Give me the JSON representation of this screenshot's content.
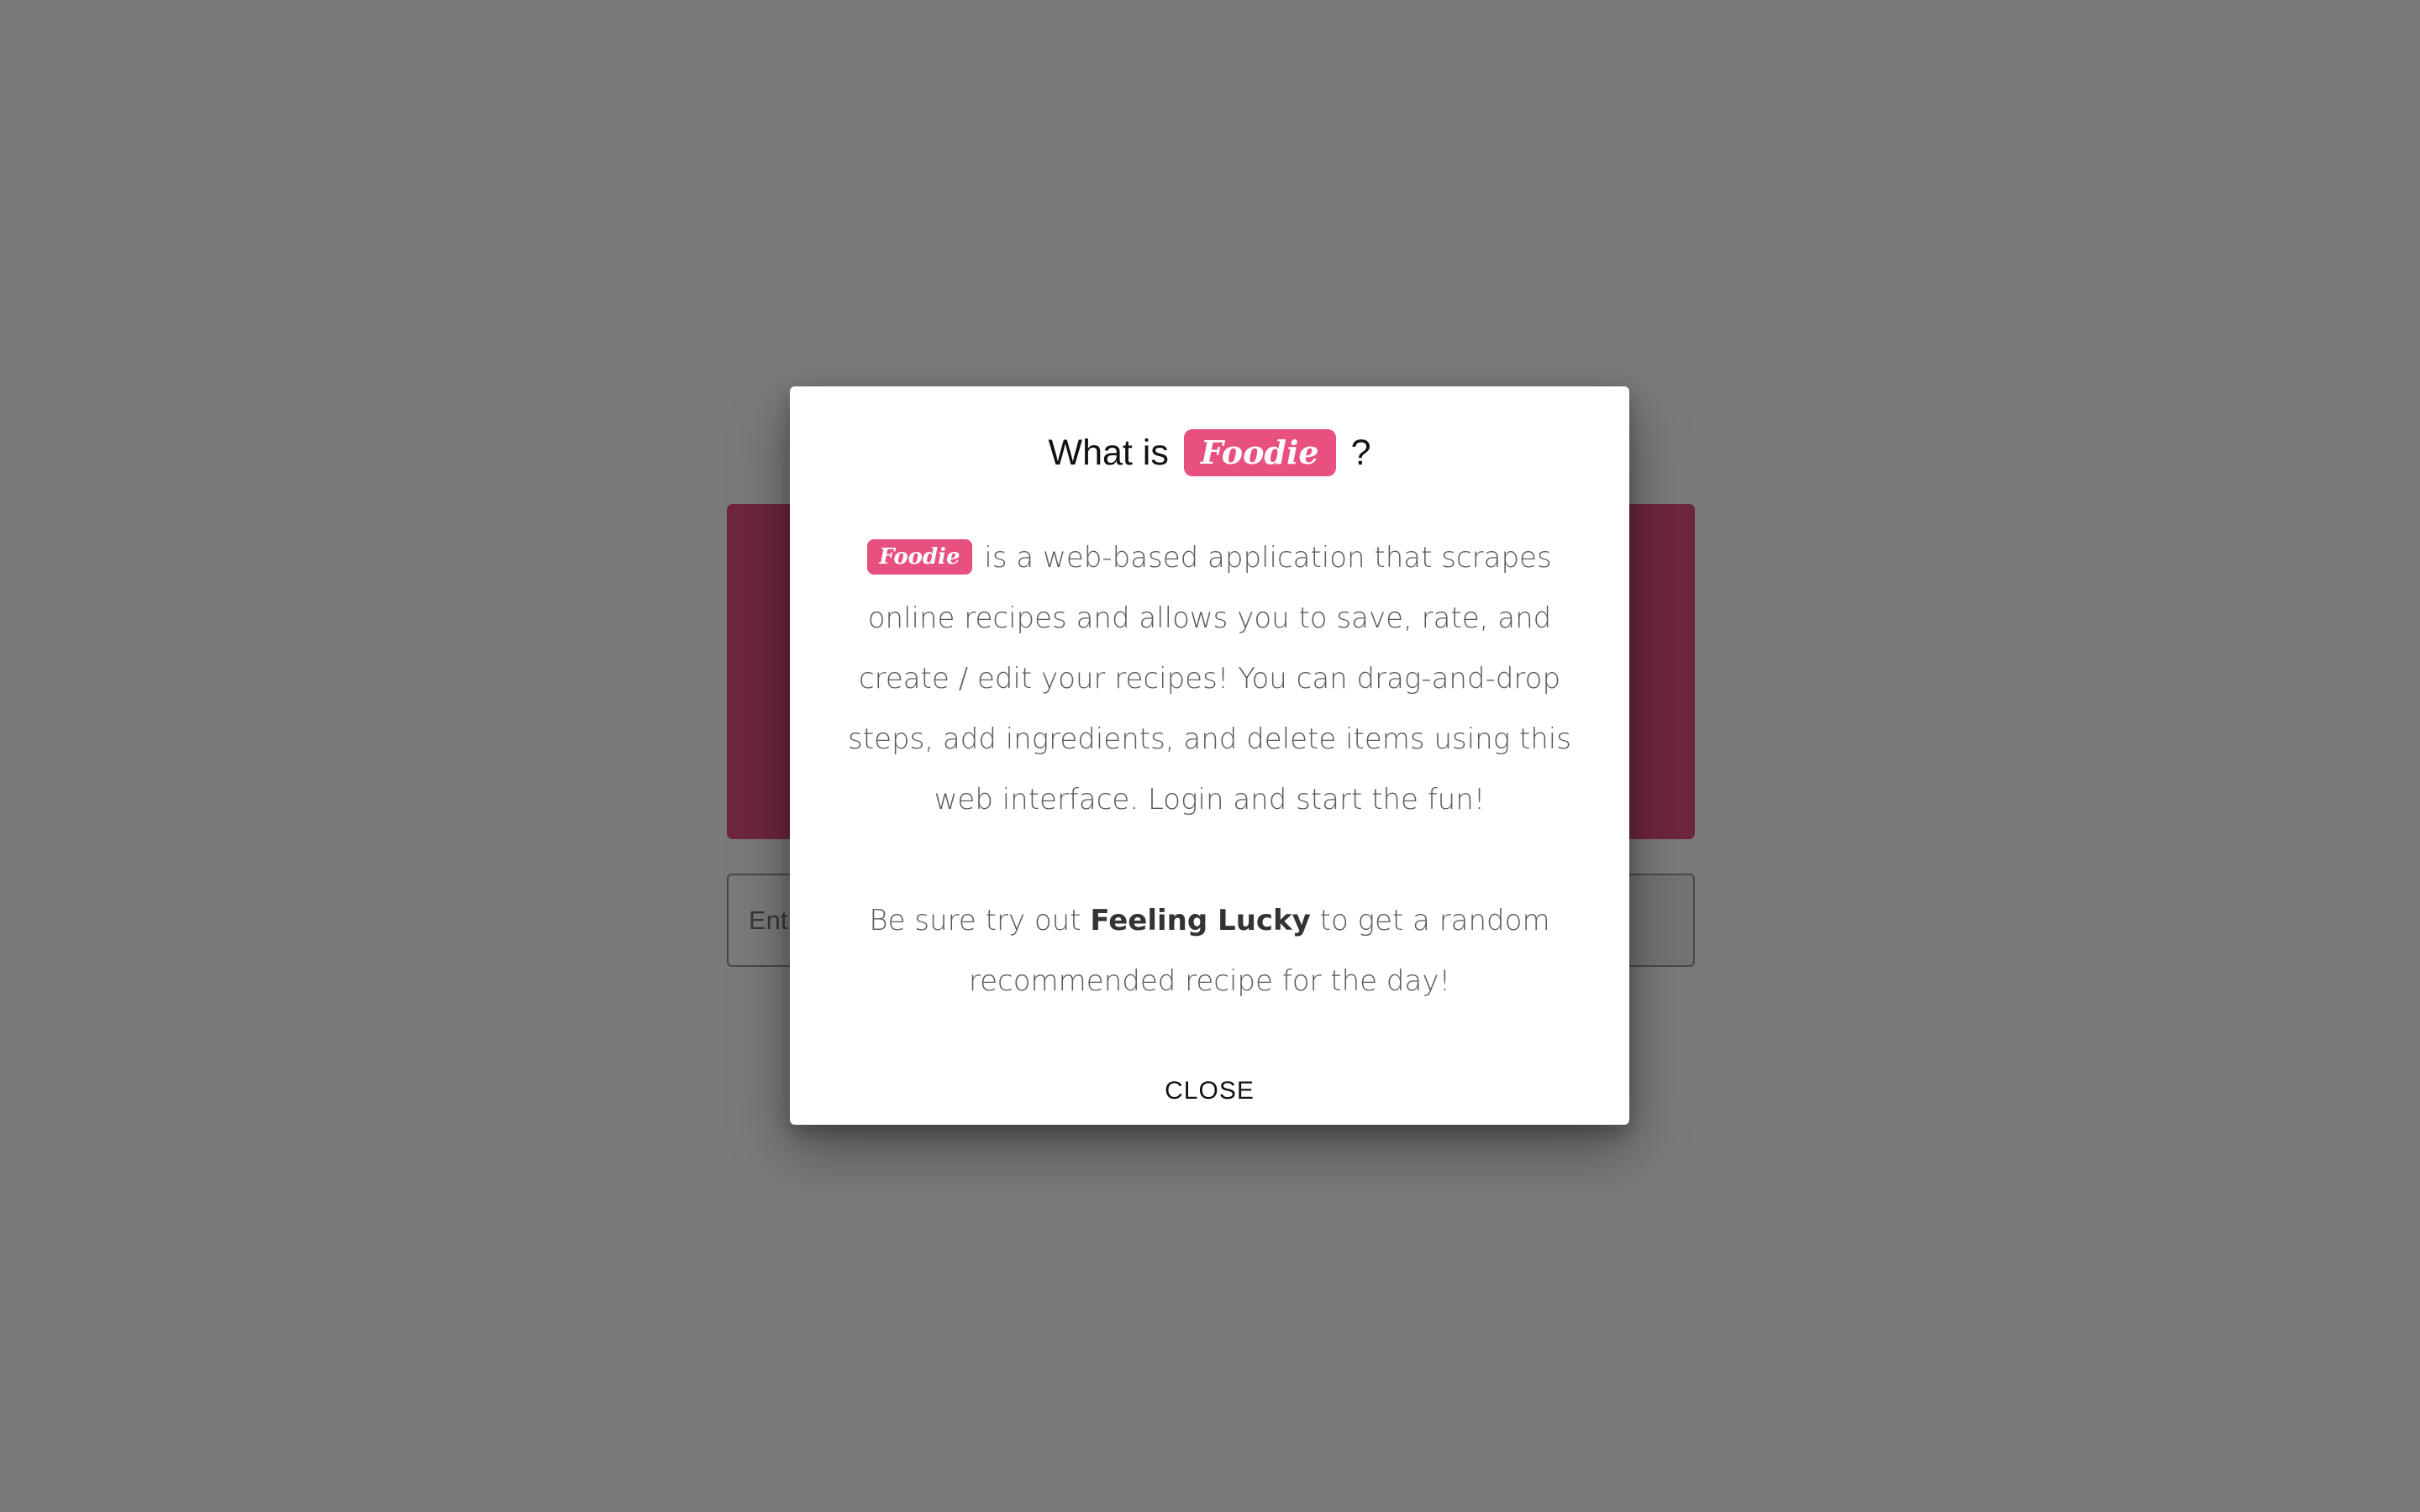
{
  "colors": {
    "brand_pink": "#e7507f",
    "overlay": "rgba(0,0,0,0.52)"
  },
  "background_page": {
    "search": {
      "value": "",
      "placeholder": "Ent"
    }
  },
  "modal": {
    "title_prefix": "What is",
    "title_brand": "Foodie",
    "title_suffix": "?",
    "paragraph1_brand": "Foodie",
    "paragraph1_text": "is a web-based application that scrapes online recipes and allows you to save, rate, and create / edit your recipes! You can drag-and-drop steps, add ingredients, and delete items using this web interface. Login and start the fun!",
    "paragraph2_before": "Be sure try out",
    "paragraph2_bold": "Feeling Lucky",
    "paragraph2_after": "to get a random recommended recipe for the day!",
    "close_label": "CLOSE"
  }
}
